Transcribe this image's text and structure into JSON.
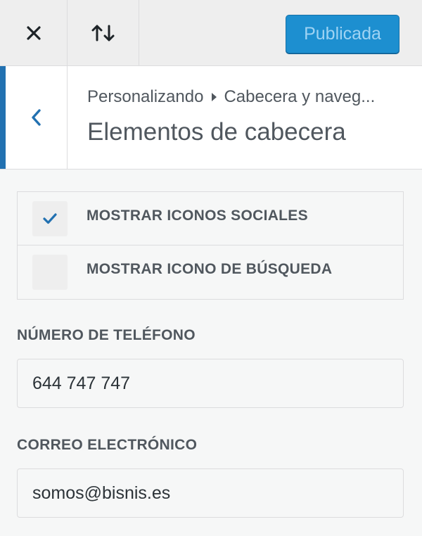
{
  "toolbar": {
    "close_icon": "close-icon",
    "sort_icon": "sort-arrows-icon",
    "publish_label": "Publicada"
  },
  "section": {
    "back_icon": "chevron-left-icon",
    "breadcrumb": {
      "root": "Personalizando",
      "current": "Cabecera y naveg..."
    },
    "title": "Elementos de cabecera"
  },
  "options": {
    "social_icons": {
      "label": "MOSTRAR ICONOS SOCIALES",
      "checked": true
    },
    "search_icon": {
      "label": "MOSTRAR ICONO DE BÚSQUEDA",
      "checked": false
    }
  },
  "fields": {
    "phone": {
      "label": "NÚMERO DE TELÉFONO",
      "value": "644 747 747"
    },
    "email": {
      "label": "CORREO ELECTRÓNICO",
      "value": "somos@bisnis.es"
    }
  },
  "colors": {
    "accent": "#2271b1",
    "publish_bg": "#1d8fd0",
    "publish_text": "#9fd3f3",
    "check": "#2271b1"
  }
}
